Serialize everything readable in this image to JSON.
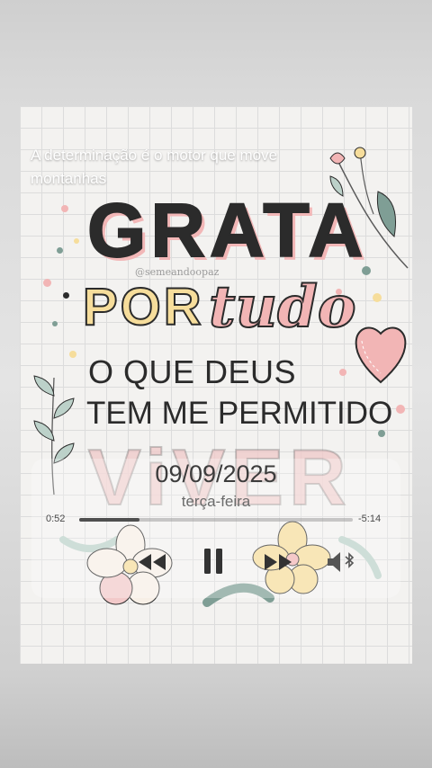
{
  "caption": "A determinação é o motor que move montanhas",
  "artwork": {
    "line_grata": "GRATA",
    "handle": "@semeandoopaz",
    "line_por": "POR",
    "line_tudo": "tudo",
    "line_o_que_deus": "O QUE DEUS",
    "line_tem_me_permitido": "TEM ME PERMITIDO",
    "line_viver": "ViVER"
  },
  "player": {
    "date": "09/09/2025",
    "weekday": "terça-feira",
    "elapsed": "0:52",
    "remaining": "-5:14",
    "progress_fraction": 0.22,
    "controls": {
      "rewind": "rewind-icon",
      "pause": "pause-icon",
      "forward": "fast-forward-icon",
      "output": "bluetooth-speaker-icon"
    }
  },
  "colors": {
    "pink": "#f2b5b5",
    "yellow": "#f6dd9b",
    "ink": "#2b2b2b",
    "leaf": "#7f9e95"
  }
}
